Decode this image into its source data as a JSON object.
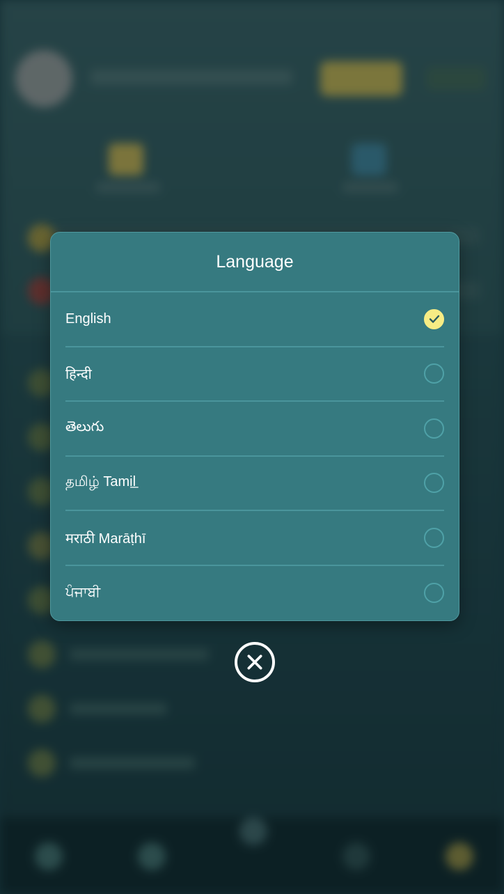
{
  "modal": {
    "title": "Language",
    "options": [
      {
        "label": "English",
        "selected": true
      },
      {
        "label": "हिन्दी",
        "selected": false
      },
      {
        "label": "తెలుగు",
        "selected": false
      },
      {
        "label": "தமிழ் Tamil̲",
        "selected": false
      },
      {
        "label": "मराठी Marāṭhī",
        "selected": false
      },
      {
        "label": "ਪੰਜਾਬੀ",
        "selected": false
      }
    ]
  },
  "icons": {
    "check": "check-icon",
    "close": "close-icon"
  },
  "colors": {
    "modal_bg": "#367a80",
    "selected_radio": "#f7ec84",
    "divider": "#4a959c"
  }
}
